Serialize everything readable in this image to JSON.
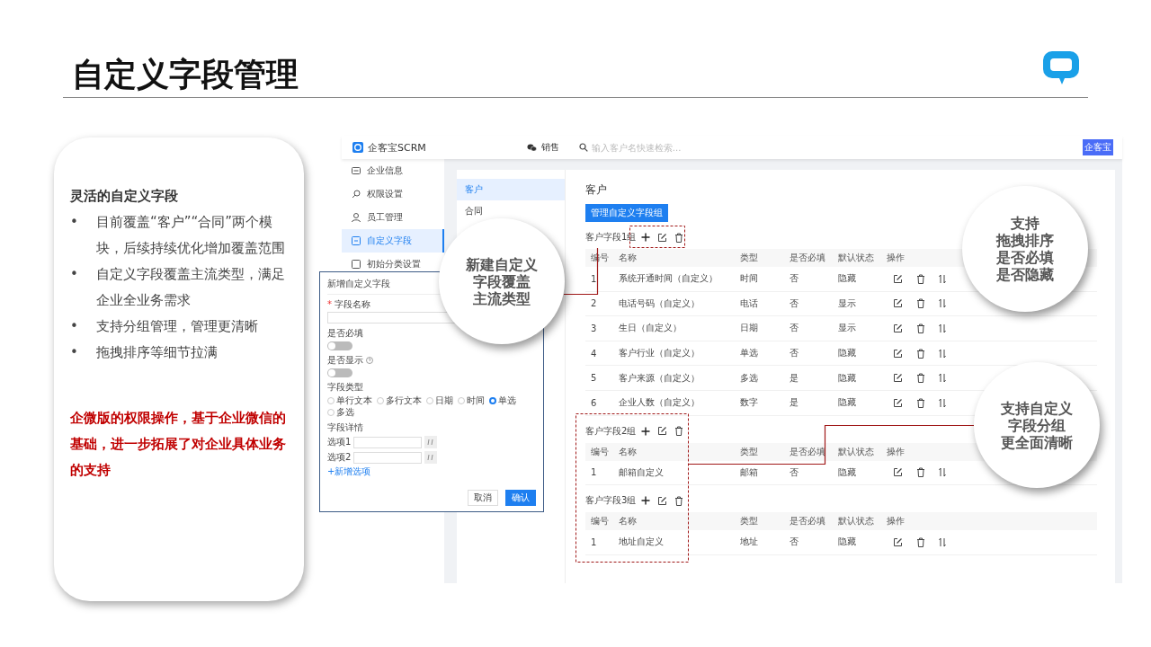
{
  "slide": {
    "title": "自定义字段管理"
  },
  "summary": {
    "heading": "灵活的自定义字段",
    "marker": "•",
    "bullets": [
      "目前覆盖“客户”“合同”两个模块，后续持续优化增加覆盖范围",
      "自定义字段覆盖主流类型，满足企业全业务需求",
      "支持分组管理，管理更清晰",
      "拖拽排序等细节拉满"
    ],
    "note": "企微版的权限操作，基于企业微信的基础，进一步拓展了对企业具体业务的支持"
  },
  "app": {
    "brand": "企客宝SCRM",
    "module": "销售",
    "search": {
      "placeholder": "输入客户名快速检索..."
    },
    "avatar": "企客宝",
    "menu": [
      {
        "label": "企业信息",
        "selected": false
      },
      {
        "label": "权限设置",
        "selected": false
      },
      {
        "label": "员工管理",
        "selected": false
      },
      {
        "label": "自定义字段",
        "selected": true
      },
      {
        "label": "初始分类设置",
        "selected": false
      }
    ],
    "subnav": [
      {
        "label": "客户",
        "selected": true
      },
      {
        "label": "合同",
        "selected": false
      }
    ],
    "page_title": "客户",
    "manage_button": "管理自定义字段组",
    "groups": [
      {
        "title": "客户字段1组",
        "columns": [
          "编号",
          "名称",
          "类型",
          "是否必填",
          "默认状态",
          "操作"
        ],
        "rows": [
          {
            "cells": [
              "1",
              "系统开通时间（自定义）",
              "时间",
              "否",
              "隐藏"
            ]
          },
          {
            "cells": [
              "2",
              "电话号码（自定义）",
              "电话",
              "否",
              "显示"
            ]
          },
          {
            "cells": [
              "3",
              "生日（自定义）",
              "日期",
              "否",
              "显示"
            ]
          },
          {
            "cells": [
              "4",
              "客户行业（自定义）",
              "单选",
              "否",
              "隐藏"
            ]
          },
          {
            "cells": [
              "5",
              "客户来源（自定义）",
              "多选",
              "是",
              "隐藏"
            ]
          },
          {
            "cells": [
              "6",
              "企业人数（自定义）",
              "数字",
              "是",
              "隐藏"
            ]
          }
        ]
      },
      {
        "title": "客户字段2组",
        "columns": [
          "编号",
          "名称",
          "类型",
          "是否必填",
          "默认状态",
          "操作"
        ],
        "rows": [
          {
            "cells": [
              "1",
              "邮箱自定义",
              "邮箱",
              "否",
              "隐藏"
            ]
          }
        ]
      },
      {
        "title": "客户字段3组",
        "columns": [
          "编号",
          "名称",
          "类型",
          "是否必填",
          "默认状态",
          "操作"
        ],
        "rows": [
          {
            "cells": [
              "1",
              "地址自定义",
              "地址",
              "否",
              "隐藏"
            ]
          }
        ]
      }
    ]
  },
  "dialog": {
    "title": "新增自定义字段",
    "name_field": {
      "mark": "*",
      "label": "字段名称"
    },
    "toggles": [
      {
        "label": "是否必填",
        "help": false,
        "on": false
      },
      {
        "label": "是否显示",
        "help": true,
        "on": false
      }
    ],
    "type_label": "字段类型",
    "types": [
      {
        "label": "单行文本",
        "selected": false
      },
      {
        "label": "多行文本",
        "selected": false
      },
      {
        "label": "日期",
        "selected": false
      },
      {
        "label": "时间",
        "selected": false
      },
      {
        "label": "单选",
        "selected": true
      },
      {
        "label": "多选",
        "selected": false
      }
    ],
    "detail_label": "字段详情",
    "options": [
      {
        "label": "选项1"
      },
      {
        "label": "选项2"
      }
    ],
    "add_option": "+新增选项",
    "buttons": [
      {
        "label": "取消",
        "kind": "secondary"
      },
      {
        "label": "确认",
        "kind": "primary"
      }
    ]
  },
  "callouts": [
    {
      "lines": [
        "新建自定义",
        "字段覆盖",
        "主流类型"
      ]
    },
    {
      "lines": [
        "支持",
        "拖拽排序",
        "是否必填",
        "是否隐藏"
      ]
    },
    {
      "lines": [
        "支持自定义",
        "字段分组",
        "更全面清晰"
      ]
    }
  ]
}
